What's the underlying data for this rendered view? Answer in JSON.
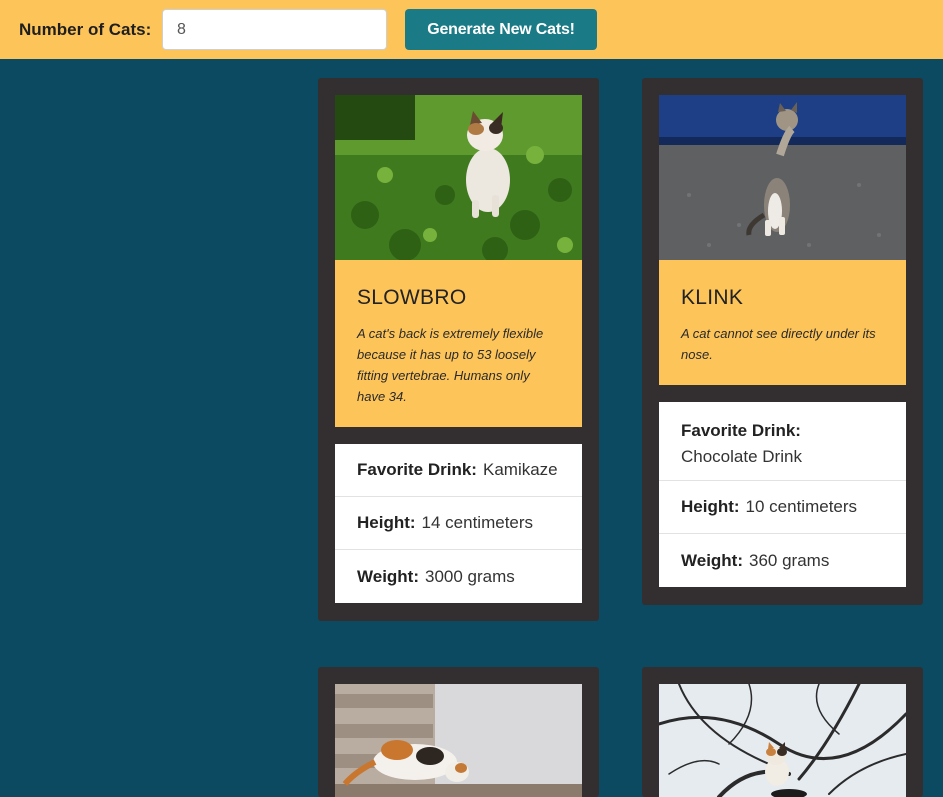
{
  "controls": {
    "label": "Number of Cats:",
    "count_value": "8",
    "generate_label": "Generate New Cats!"
  },
  "cats": [
    {
      "name": "SLOWBRO",
      "fact": "A cat's back is extremely flexible because it has up to 53 loosely fitting vertebrae. Humans only have 34.",
      "drink_label": "Favorite Drink:",
      "drink": "Kamikaze",
      "height_label": "Height:",
      "height": "14 centimeters",
      "weight_label": "Weight:",
      "weight": "3000 grams"
    },
    {
      "name": "KLINK",
      "fact": "A cat cannot see directly under its nose.",
      "drink_label": "Favorite Drink:",
      "drink": "Chocolate Drink",
      "height_label": "Height:",
      "height": "10 centimeters",
      "weight_label": "Weight:",
      "weight": "360 grams"
    }
  ]
}
